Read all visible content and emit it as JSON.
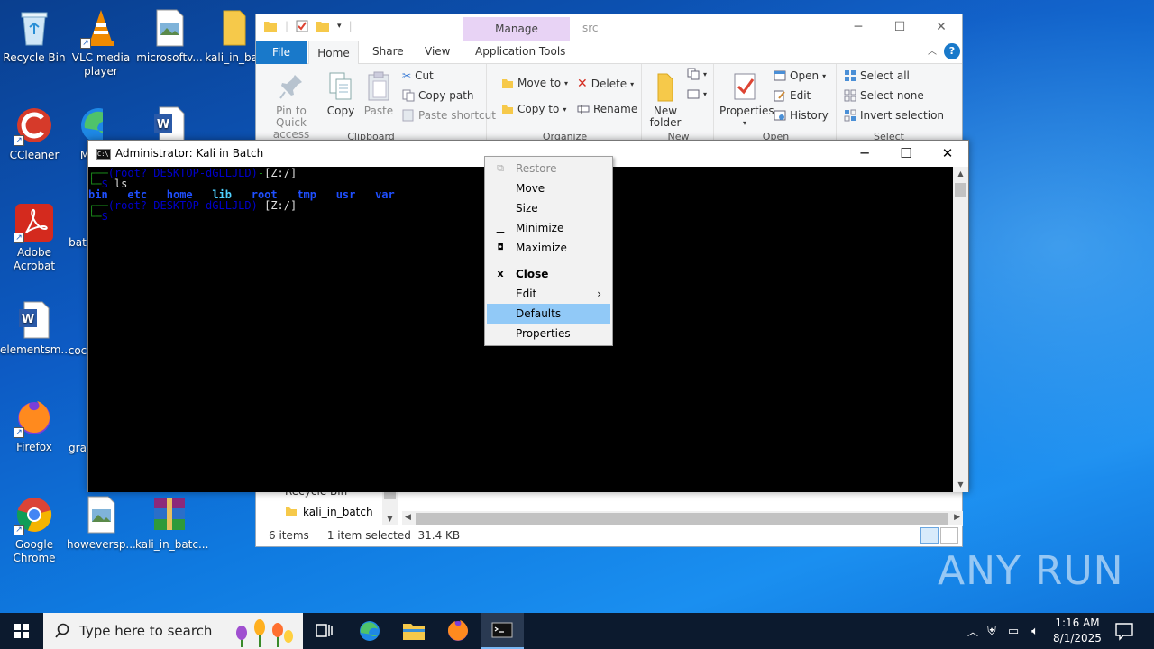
{
  "desktop": {
    "icons": [
      {
        "label": "Recycle Bin"
      },
      {
        "label": "VLC media player"
      },
      {
        "label": "microsoftv..."
      },
      {
        "label": "kali_in_bat"
      },
      {
        "label": "CCleaner"
      },
      {
        "label": "M"
      },
      {
        "label": "Adobe Acrobat"
      },
      {
        "label": "bat"
      },
      {
        "label": "elementsm..."
      },
      {
        "label": "coc"
      },
      {
        "label": "Firefox"
      },
      {
        "label": "gra"
      },
      {
        "label": "Google Chrome"
      },
      {
        "label": "howeversp..."
      },
      {
        "label": "kali_in_batc..."
      }
    ]
  },
  "explorer": {
    "title": "src",
    "manage_tab": "Manage",
    "tabs": {
      "file": "File",
      "home": "Home",
      "share": "Share",
      "view": "View",
      "app_tools": "Application Tools"
    },
    "clipboard": {
      "pin": "Pin to Quick access",
      "copy": "Copy",
      "paste": "Paste",
      "cut": "Cut",
      "copy_path": "Copy path",
      "paste_shortcut": "Paste shortcut",
      "label": "Clipboard"
    },
    "organize": {
      "move_to": "Move to",
      "copy_to": "Copy to",
      "delete": "Delete",
      "rename": "Rename",
      "label": "Organize"
    },
    "new": {
      "new_folder": "New folder",
      "label": "New"
    },
    "open": {
      "properties": "Properties",
      "open": "Open",
      "edit": "Edit",
      "history": "History",
      "label": "Open"
    },
    "select": {
      "select_all": "Select all",
      "select_none": "Select none",
      "invert": "Invert selection",
      "label": "Select"
    },
    "nav": {
      "recycle": "Recycle Bin",
      "kali": "kali_in_batch"
    },
    "status": {
      "items": "6 items",
      "selected": "1 item selected",
      "size": "31.4 KB"
    }
  },
  "console": {
    "title": "Administrator:  Kali in Batch",
    "prompt_user": "(root? DESKTOP-dGLLJLD)",
    "prompt_path": "[Z:/]",
    "command": "ls",
    "listing": [
      "bin",
      "etc",
      "home",
      "lib",
      "root",
      "tmp",
      "usr",
      "var"
    ]
  },
  "context_menu": {
    "items": [
      {
        "label": "Restore"
      },
      {
        "label": "Move"
      },
      {
        "label": "Size"
      },
      {
        "label": "Minimize"
      },
      {
        "label": "Maximize"
      },
      {
        "label": "Close"
      },
      {
        "label": "Edit"
      },
      {
        "label": "Defaults"
      },
      {
        "label": "Properties"
      }
    ]
  },
  "taskbar": {
    "search_placeholder": "Type here to search",
    "time": "1:16 AM",
    "date": "8/1/2025"
  },
  "watermark": "ANY RUN",
  "colors": {
    "accent": "#1979ca",
    "menu_highlight": "#91c9f7",
    "taskbar": "#0c1a2e"
  }
}
